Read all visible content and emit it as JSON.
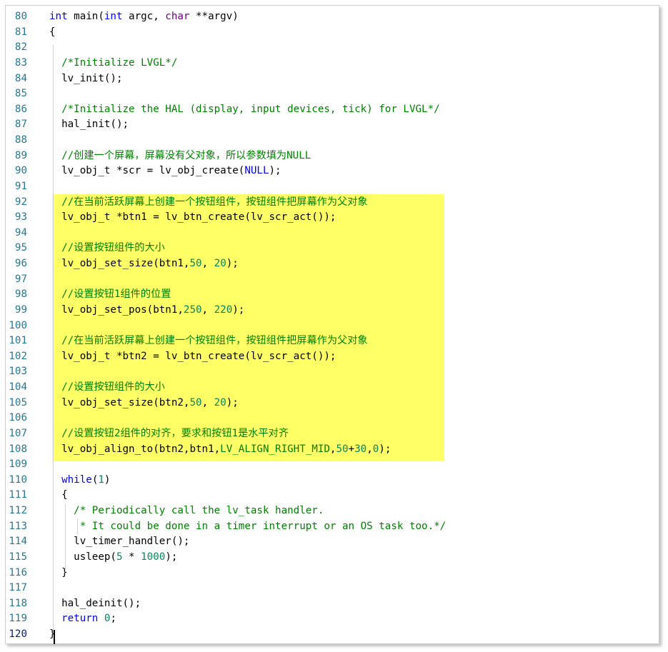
{
  "editor": {
    "lines": [
      {
        "num": "80",
        "tokens": [
          {
            "t": "int",
            "c": "k"
          },
          {
            "t": " main("
          },
          {
            "t": "int",
            "c": "k"
          },
          {
            "t": " argc, "
          },
          {
            "t": "char",
            "c": "m"
          },
          {
            "t": " **argv)"
          }
        ]
      },
      {
        "num": "81",
        "tokens": [
          {
            "t": "{"
          }
        ]
      },
      {
        "num": "82",
        "tokens": []
      },
      {
        "num": "83",
        "tokens": [
          {
            "t": "  "
          },
          {
            "t": "/*Initialize LVGL*/",
            "c": "c"
          }
        ]
      },
      {
        "num": "84",
        "tokens": [
          {
            "t": "  lv_init();"
          }
        ]
      },
      {
        "num": "85",
        "tokens": []
      },
      {
        "num": "86",
        "tokens": [
          {
            "t": "  "
          },
          {
            "t": "/*Initialize the HAL (display, input devices, tick) for LVGL*/",
            "c": "c"
          }
        ]
      },
      {
        "num": "87",
        "tokens": [
          {
            "t": "  hal_init();"
          }
        ]
      },
      {
        "num": "88",
        "tokens": []
      },
      {
        "num": "89",
        "tokens": [
          {
            "t": "  "
          },
          {
            "t": "//创建一个屏幕，屏幕没有父对象，所以参数填为NULL",
            "c": "c"
          }
        ]
      },
      {
        "num": "90",
        "tokens": [
          {
            "t": "  lv_obj_t *scr = lv_obj_create("
          },
          {
            "t": "NULL",
            "c": "k"
          },
          {
            "t": ");"
          }
        ]
      },
      {
        "num": "91",
        "tokens": []
      },
      {
        "num": "92",
        "tokens": [
          {
            "t": "  "
          },
          {
            "t": "//在当前活跃屏幕上创建一个按钮组件，按钮组件把屏幕作为父对象",
            "c": "c"
          }
        ]
      },
      {
        "num": "93",
        "tokens": [
          {
            "t": "  lv_obj_t *btn1 = lv_btn_create(lv_scr_act());"
          }
        ]
      },
      {
        "num": "94",
        "tokens": []
      },
      {
        "num": "95",
        "tokens": [
          {
            "t": "  "
          },
          {
            "t": "//设置按钮组件的大小",
            "c": "c"
          }
        ]
      },
      {
        "num": "96",
        "tokens": [
          {
            "t": "  lv_obj_set_size(btn1,"
          },
          {
            "t": "50",
            "c": "n"
          },
          {
            "t": ", "
          },
          {
            "t": "20",
            "c": "n"
          },
          {
            "t": ");"
          }
        ]
      },
      {
        "num": "97",
        "tokens": []
      },
      {
        "num": "98",
        "tokens": [
          {
            "t": "  "
          },
          {
            "t": "//设置按钮1组件的位置",
            "c": "c"
          }
        ]
      },
      {
        "num": "99",
        "tokens": [
          {
            "t": "  lv_obj_set_pos(btn1,"
          },
          {
            "t": "250",
            "c": "n"
          },
          {
            "t": ", "
          },
          {
            "t": "220",
            "c": "n"
          },
          {
            "t": ");"
          }
        ]
      },
      {
        "num": "100",
        "tokens": []
      },
      {
        "num": "101",
        "tokens": [
          {
            "t": "  "
          },
          {
            "t": "//在当前活跃屏幕上创建一个按钮组件，按钮组件把屏幕作为父对象",
            "c": "c"
          }
        ]
      },
      {
        "num": "102",
        "tokens": [
          {
            "t": "  lv_obj_t *btn2 = lv_btn_create(lv_scr_act());"
          }
        ]
      },
      {
        "num": "103",
        "tokens": []
      },
      {
        "num": "104",
        "tokens": [
          {
            "t": "  "
          },
          {
            "t": "//设置按钮组件的大小",
            "c": "c"
          }
        ]
      },
      {
        "num": "105",
        "tokens": [
          {
            "t": "  lv_obj_set_size(btn2,"
          },
          {
            "t": "50",
            "c": "n"
          },
          {
            "t": ", "
          },
          {
            "t": "20",
            "c": "n"
          },
          {
            "t": ");"
          }
        ]
      },
      {
        "num": "106",
        "tokens": []
      },
      {
        "num": "107",
        "tokens": [
          {
            "t": "  "
          },
          {
            "t": "//设置按钮2组件的对齐，要求和按钮1是水平对齐",
            "c": "c"
          }
        ]
      },
      {
        "num": "108",
        "tokens": [
          {
            "t": "  lv_obj_align_to(btn2,btn1,"
          },
          {
            "t": "LV_ALIGN_RIGHT_MID",
            "c": "mk"
          },
          {
            "t": ","
          },
          {
            "t": "50",
            "c": "n"
          },
          {
            "t": "+"
          },
          {
            "t": "30",
            "c": "n"
          },
          {
            "t": ","
          },
          {
            "t": "0",
            "c": "n"
          },
          {
            "t": ");"
          }
        ]
      },
      {
        "num": "109",
        "tokens": []
      },
      {
        "num": "110",
        "tokens": [
          {
            "t": "  "
          },
          {
            "t": "while",
            "c": "k"
          },
          {
            "t": "("
          },
          {
            "t": "1",
            "c": "n"
          },
          {
            "t": ")"
          }
        ]
      },
      {
        "num": "111",
        "tokens": [
          {
            "t": "  {"
          }
        ]
      },
      {
        "num": "112",
        "tokens": [
          {
            "t": "    "
          },
          {
            "t": "/* Periodically call the lv_task handler.",
            "c": "c"
          }
        ]
      },
      {
        "num": "113",
        "tokens": [
          {
            "t": "     "
          },
          {
            "t": "* It could be done in a timer interrupt or an OS task too.*/",
            "c": "c"
          }
        ]
      },
      {
        "num": "114",
        "tokens": [
          {
            "t": "    lv_timer_handler();"
          }
        ]
      },
      {
        "num": "115",
        "tokens": [
          {
            "t": "    usleep("
          },
          {
            "t": "5",
            "c": "n"
          },
          {
            "t": " * "
          },
          {
            "t": "1000",
            "c": "n"
          },
          {
            "t": ");"
          }
        ]
      },
      {
        "num": "116",
        "tokens": [
          {
            "t": "  }"
          }
        ]
      },
      {
        "num": "117",
        "tokens": []
      },
      {
        "num": "118",
        "tokens": [
          {
            "t": "  hal_deinit();"
          }
        ]
      },
      {
        "num": "119",
        "tokens": [
          {
            "t": "  "
          },
          {
            "t": "return",
            "c": "k"
          },
          {
            "t": " "
          },
          {
            "t": "0",
            "c": "n"
          },
          {
            "t": ";"
          }
        ]
      },
      {
        "num": "120",
        "tokens": [
          {
            "t": "}"
          }
        ],
        "current": true
      }
    ]
  }
}
